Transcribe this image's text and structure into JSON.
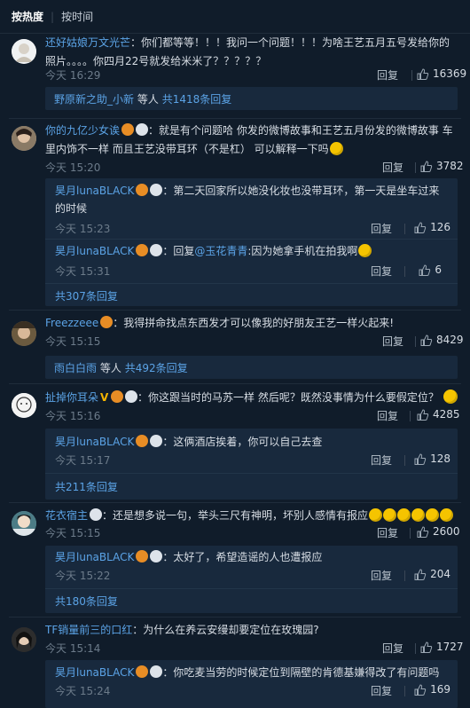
{
  "sort": {
    "hot": "按热度",
    "time": "按时间"
  },
  "labels": {
    "reply": "回复",
    "deng_ren": "等人",
    "today": "今天"
  },
  "comments": [
    {
      "user": "还好姑娘万文光芒",
      "text": "你们都等等！！！我问一个问题！！！为啥王艺五月五号发给你的照片。。。。你四月22号就发给米米了？？？？？",
      "time": "今天 16:29",
      "likes": "16369",
      "summary_user": "野原新之助_小新",
      "summary_count": "共1418条回复"
    },
    {
      "user": "你的九亿少女诶",
      "text": "就是有个问题哈 你发的微博故事和王艺五月份发的微博故事 车里内饰不一样 而且王艺没带耳环（不是杠） 可以解释一下吗",
      "time": "今天 15:20",
      "likes": "3782",
      "replies": [
        {
          "user": "昊月lunaBLACK",
          "text": "第二天回家所以她没化妆也没带耳环，第一天是坐车过来的时候",
          "time": "今天 15:23",
          "likes": "126"
        },
        {
          "user": "昊月lunaBLACK",
          "reply_word": "回复",
          "mention": "@玉花青青",
          "text": ":因为她拿手机在拍我啊",
          "time": "今天 15:31",
          "likes": "6"
        }
      ],
      "more": "共307条回复"
    },
    {
      "user": "Freezzeee",
      "text": "我得拼命找点东西发才可以像我的好朋友王艺一样火起来!",
      "time": "今天 15:15",
      "likes": "8429",
      "summary_user": "雨白白雨",
      "summary_count": "共492条回复"
    },
    {
      "user": "扯掉你耳朵",
      "text": "你这跟当时的马苏一样 然后呢？既然没事情为什么要假定位？",
      "time": "今天 15:16",
      "likes": "4285",
      "replies": [
        {
          "user": "昊月lunaBLACK",
          "text": "这俩酒店挨着，你可以自己去查",
          "time": "今天 15:17",
          "likes": "128"
        }
      ],
      "more": "共211条回复"
    },
    {
      "user": "花衣宿主",
      "text": "还是想多说一句，举头三尺有神明，坏别人感情有报应",
      "time": "今天 15:15",
      "likes": "2600",
      "replies": [
        {
          "user": "昊月lunaBLACK",
          "text": "太好了，希望造谣的人也遭报应",
          "time": "今天 15:22",
          "likes": "204"
        }
      ],
      "more": "共180条回复"
    },
    {
      "user": "TF销量前三的口红",
      "text": "为什么在养云安缦却要定位在玫瑰园?",
      "time": "今天 15:14",
      "likes": "1727",
      "replies": [
        {
          "user": "昊月lunaBLACK",
          "text": "你吃麦当劳的时候定位到隔壁的肯德基嫌得改了有问题吗",
          "time": "今天 15:24",
          "likes": "169"
        }
      ]
    }
  ],
  "colors": {
    "background": "#101c2a",
    "link": "#5ba3e6",
    "subbox": "#18293d",
    "meta": "#6c7b8a"
  },
  "icons": [
    "thumb-up-icon",
    "vip-badge-icon",
    "skull-badge-icon",
    "smile-emoji-icon",
    "v-badge-icon"
  ]
}
